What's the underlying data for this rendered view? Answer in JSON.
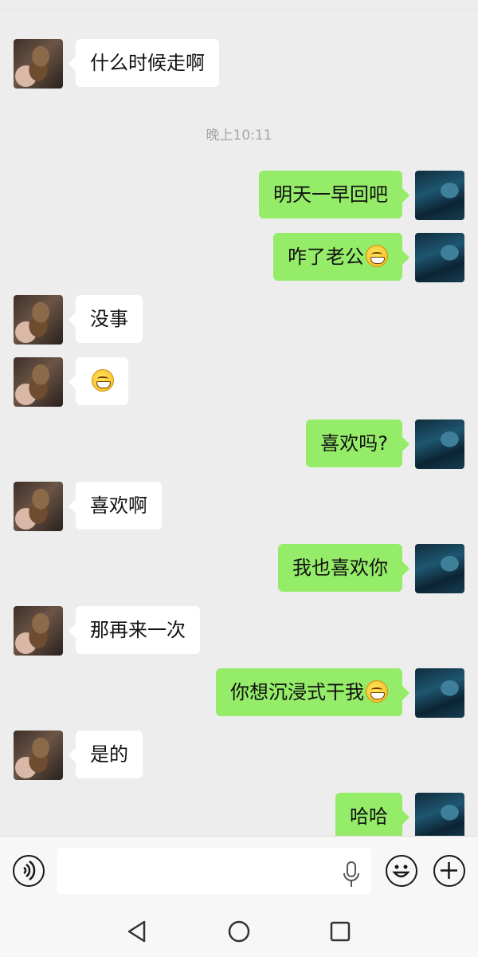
{
  "chat": {
    "timestamp": "晚上10:11",
    "messages": [
      {
        "side": "left",
        "text": "什么时候走啊",
        "emoji": false
      },
      {
        "side": "right",
        "text": "明天一早回吧",
        "emoji": false
      },
      {
        "side": "right",
        "text": "咋了老公",
        "emoji": true
      },
      {
        "side": "left",
        "text": "没事",
        "emoji": false
      },
      {
        "side": "left",
        "text": "",
        "emoji": true
      },
      {
        "side": "right",
        "text": "喜欢吗?",
        "emoji": false
      },
      {
        "side": "left",
        "text": "喜欢啊",
        "emoji": false
      },
      {
        "side": "right",
        "text": "我也喜欢你",
        "emoji": false
      },
      {
        "side": "left",
        "text": "那再来一次",
        "emoji": false
      },
      {
        "side": "right",
        "text": "你想沉浸式干我",
        "emoji": true
      },
      {
        "side": "left",
        "text": "是的",
        "emoji": false
      },
      {
        "side": "right",
        "text": "哈哈",
        "emoji": false
      }
    ]
  },
  "input_bar": {
    "voice_icon": "voice-icon",
    "mic_icon": "mic-icon",
    "emoji_icon": "emoji-icon",
    "plus_icon": "plus-icon"
  },
  "nav_bar": {
    "back_icon": "back-triangle-icon",
    "home_icon": "home-circle-icon",
    "recent_icon": "recent-square-icon"
  },
  "colors": {
    "background": "#ededed",
    "sent_bubble": "#95ec69",
    "received_bubble": "#ffffff",
    "timestamp_text": "#a6a6a6"
  }
}
